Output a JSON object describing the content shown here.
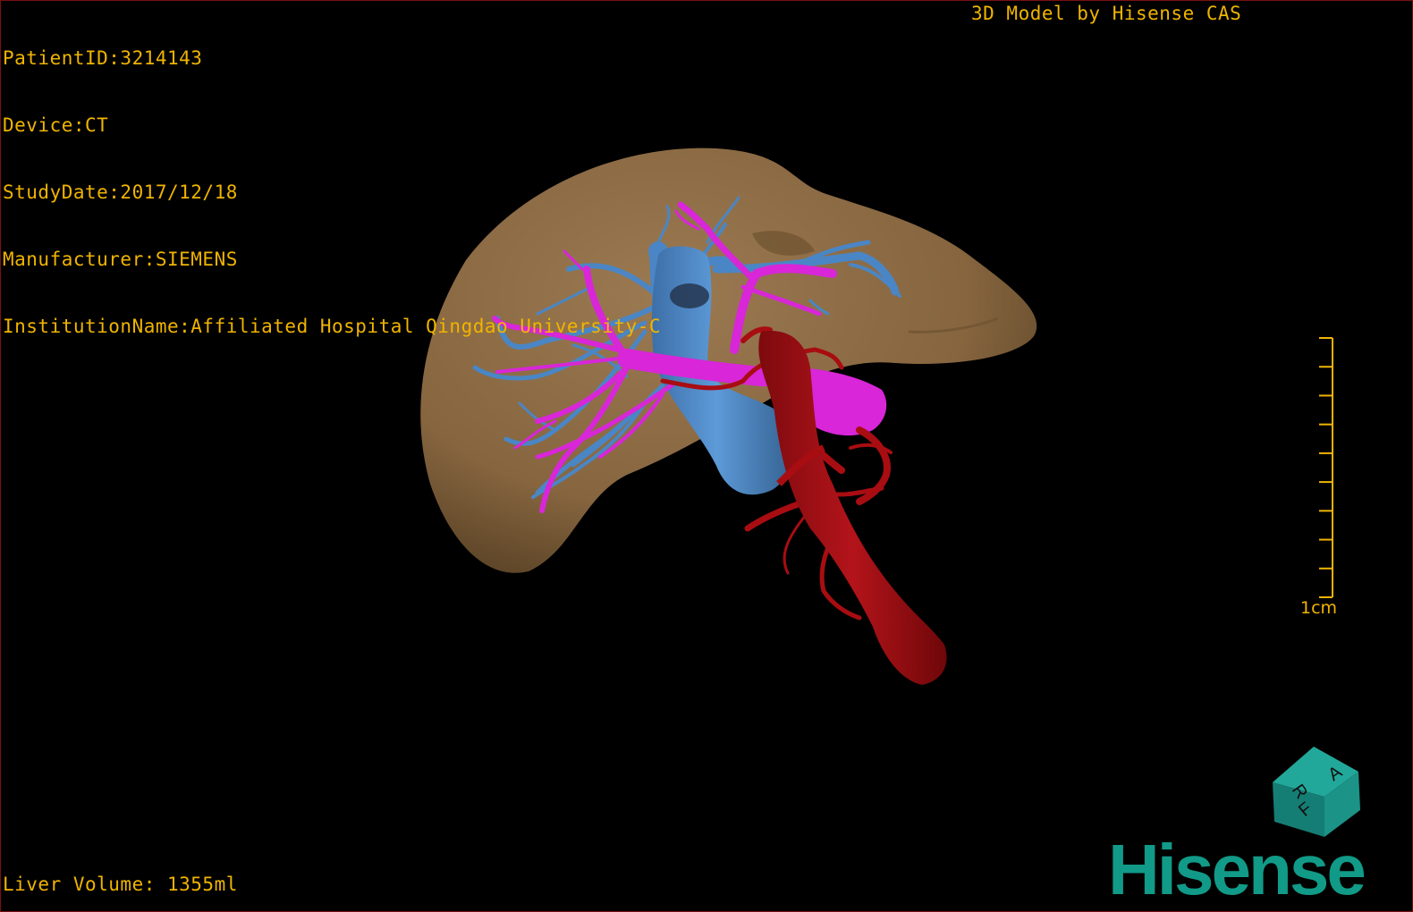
{
  "overlay": {
    "patient_id": "PatientID:3214143",
    "device": "Device:CT",
    "study_date": "StudyDate:2017/12/18",
    "manufacturer": "Manufacturer:SIEMENS",
    "institution": "InstitutionName:Affiliated Hospital Qingdao University-C",
    "title": "3D Model by Hisense CAS",
    "liver_volume": "Liver Volume: 1355ml"
  },
  "scale_bar": {
    "label": "1cm",
    "ticks": 10
  },
  "orientation_cube": {
    "labels": [
      "R",
      "A",
      "F"
    ]
  },
  "brand": {
    "logo_text": "Hisense"
  },
  "colors": {
    "liver": "#8c6a45",
    "hepatic_vein": "#4a86c5",
    "portal_vein": "#d826d8",
    "artery": "#a80d12",
    "overlay_text": "#f0b400",
    "brand": "#119a88"
  }
}
